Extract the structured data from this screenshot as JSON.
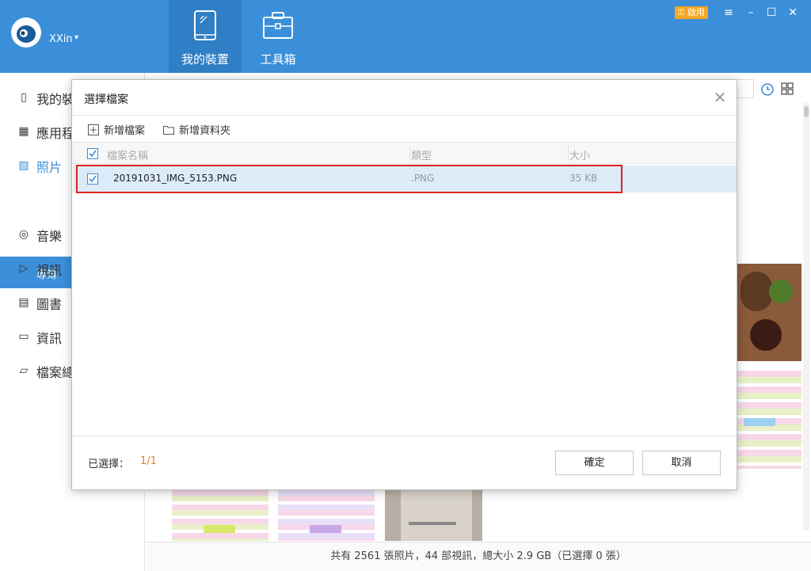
{
  "header": {
    "user_name": "XXin",
    "user_caret": "▾",
    "tabs": [
      {
        "label": "我的裝置",
        "icon": "tablet-icon",
        "active": true
      },
      {
        "label": "工具箱",
        "icon": "toolbox-icon",
        "active": false
      }
    ],
    "activate_label": "啟用",
    "window_controls": [
      "≡",
      "–",
      "☐",
      "✕"
    ]
  },
  "sidebar": {
    "items": [
      {
        "label": "我的裝",
        "icon": "phone-icon"
      },
      {
        "label": "應用程",
        "icon": "apps-grid-icon"
      },
      {
        "label": "照片",
        "icon": "image-icon"
      },
      {
        "label": "音樂",
        "icon": "music-icon"
      },
      {
        "label": "視訊",
        "icon": "video-icon"
      },
      {
        "label": "圖書",
        "icon": "book-icon"
      },
      {
        "label": "資訊",
        "icon": "message-icon"
      },
      {
        "label": "檔案總",
        "icon": "folder-icon"
      }
    ],
    "sub_item": "專簿"
  },
  "footer": {
    "status": "共有 2561 張照片，44 部視訊，總大小 2.9 GB（已選擇 0 張）"
  },
  "dialog": {
    "title": "選擇檔案",
    "close_glyph": "✕",
    "toolbar": {
      "add_file": "新增檔案",
      "add_folder": "新增資料夾"
    },
    "columns": {
      "name": "檔案名稱",
      "type": "類型",
      "size": "大小"
    },
    "files": [
      {
        "name": "20191031_IMG_5153.PNG",
        "type": ".PNG",
        "size": "35 KB",
        "checked": true
      }
    ],
    "selected_label": "已選擇：",
    "selected_count": "1/1",
    "confirm_label": "確定",
    "cancel_label": "取消"
  },
  "colors": {
    "brand_blue": "#3b8fd8",
    "highlight_red": "#e02020",
    "count_orange": "#e67e22",
    "activate_orange": "#f6a623"
  }
}
